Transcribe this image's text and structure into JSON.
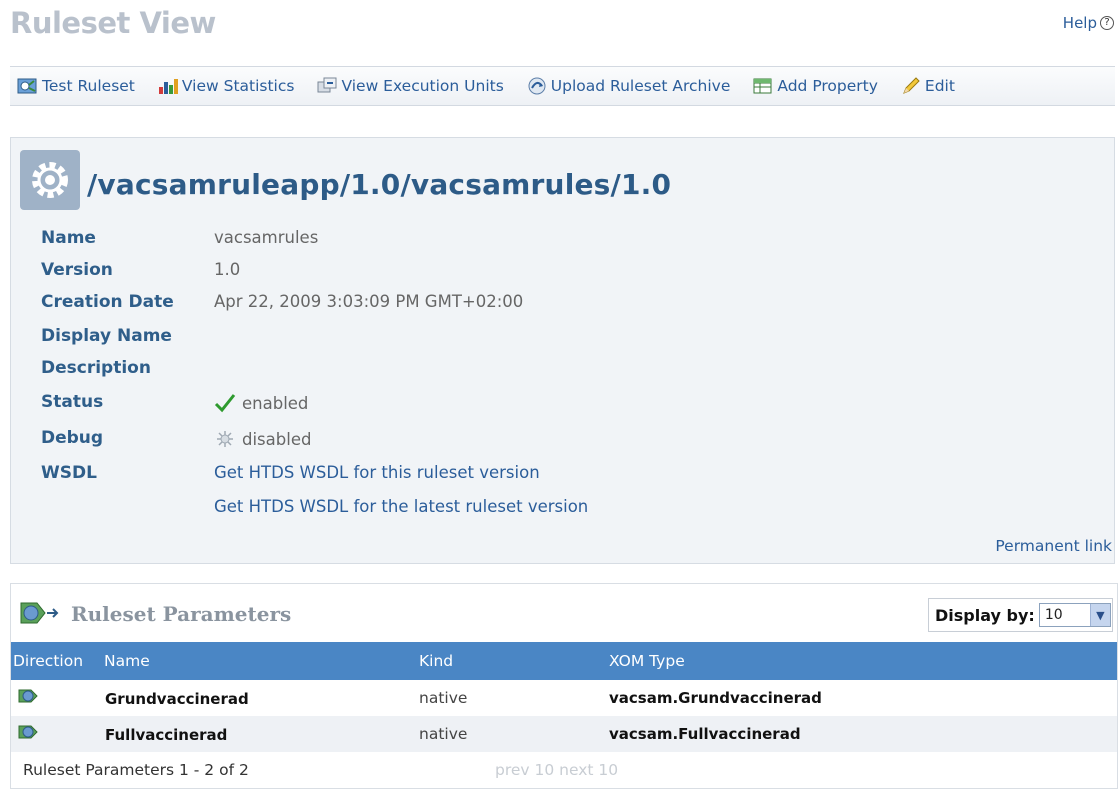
{
  "header": {
    "title": "Ruleset View",
    "help_label": "Help",
    "help_glyph": "?"
  },
  "toolbar": {
    "items": [
      {
        "label": "Test Ruleset",
        "icon": "test-ruleset-icon"
      },
      {
        "label": "View Statistics",
        "icon": "statistics-chart-icon"
      },
      {
        "label": "View Execution Units",
        "icon": "execution-units-icon"
      },
      {
        "label": "Upload Ruleset Archive",
        "icon": "upload-archive-icon"
      },
      {
        "label": "Add Property",
        "icon": "add-property-icon"
      },
      {
        "label": "Edit",
        "icon": "pencil-edit-icon"
      }
    ]
  },
  "ruleset": {
    "path": "/vacsamruleapp/1.0/vacsamrules/1.0",
    "props": {
      "name_label": "Name",
      "name_value": "vacsamrules",
      "version_label": "Version",
      "version_value": "1.0",
      "creation_label": "Creation Date",
      "creation_value": "Apr 22, 2009 3:03:09 PM GMT+02:00",
      "display_name_label": "Display Name",
      "description_label": "Description",
      "status_label": "Status",
      "status_value": "enabled",
      "debug_label": "Debug",
      "debug_value": "disabled",
      "wsdl_label": "WSDL",
      "wsdl_link_1": "Get HTDS WSDL for this ruleset version",
      "wsdl_link_2": "Get HTDS WSDL for the latest ruleset version"
    },
    "permanent_link": "Permanent link"
  },
  "parameters": {
    "title": "Ruleset Parameters",
    "display_by_label": "Display by:",
    "display_by_value": "10",
    "columns": [
      "Direction",
      "Name",
      "Kind",
      "XOM Type"
    ],
    "rows": [
      {
        "name": "Grundvaccinerad",
        "kind": "native",
        "xom": "vacsam.Grundvaccinerad"
      },
      {
        "name": "Fullvaccinerad",
        "kind": "native",
        "xom": "vacsam.Fullvaccinerad"
      }
    ],
    "footer_count": "Ruleset Parameters 1 - 2 of 2",
    "pager": "prev 10 next 10"
  },
  "colors": {
    "accent": "#2b5d9a",
    "table_header": "#4a86c5",
    "label": "#2f5e8a",
    "status_ok": "#2e9a2e"
  }
}
